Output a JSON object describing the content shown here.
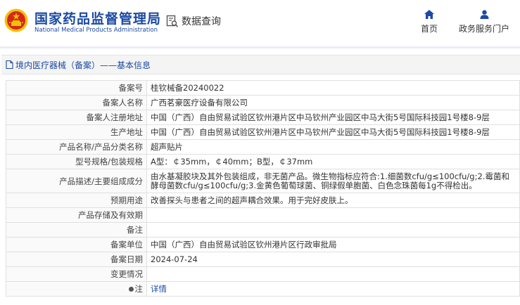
{
  "header": {
    "site_title": "国家药品监督管理局",
    "site_subtitle": "National Medical Products Administration",
    "db_query_label": "数据查询",
    "nav_home": "首页",
    "nav_portal": "政务服务门户"
  },
  "breadcrumb": {
    "text": "境内医疗器械（备案）——基本信息"
  },
  "rows": [
    {
      "key": "备案号",
      "value": "桂钦械备20240022"
    },
    {
      "key": "备案人名称",
      "value": "广西茗豪医疗设备有限公司"
    },
    {
      "key": "备案人注册地址",
      "value": "中国（广西）自由贸易试验区钦州港片区中马钦州产业园区中马大街5号国际科技园1号楼8-9层"
    },
    {
      "key": "生产地址",
      "value": "中国（广西）自由贸易试验区钦州港片区中马钦州产业园区中马大街5号国际科技园1号楼8-9层"
    },
    {
      "key": "产品名称/产品分类名称",
      "value": "超声贴片"
    },
    {
      "key": "型号规格/包装规格",
      "value": "A型：￠35mm，￠40mm；B型，￠37mm"
    },
    {
      "key": "产品描述/主要组成成分",
      "value": "由水基凝胶块及其外包装组成，非无菌产品。微生物指标应符合:1.细菌数cfu/g≤100cfu/g;2.霉菌和酵母菌数cfu/g≤100cfu/g;3.金黄色葡萄球菌、铜绿假单胞菌、白色念珠菌每1g不得检出。"
    },
    {
      "key": "预期用途",
      "value": "改善探头与患者之间的超声耦合效果。用于完好皮肤上。"
    },
    {
      "key": "产品存储及有效期",
      "value": ""
    },
    {
      "key": "备注",
      "value": ""
    },
    {
      "key": "备案单位",
      "value": "中国（广西）自由贸易试验区钦州港片区行政审批局"
    },
    {
      "key": "备案日期",
      "value": "2024-07-24"
    },
    {
      "key": "变更情况",
      "value": ""
    },
    {
      "key": "注",
      "value": "详情"
    }
  ],
  "colors": {
    "brand": "#1b4aa3",
    "emblem_red": "#d7261e",
    "emblem_gold": "#f2c200"
  }
}
